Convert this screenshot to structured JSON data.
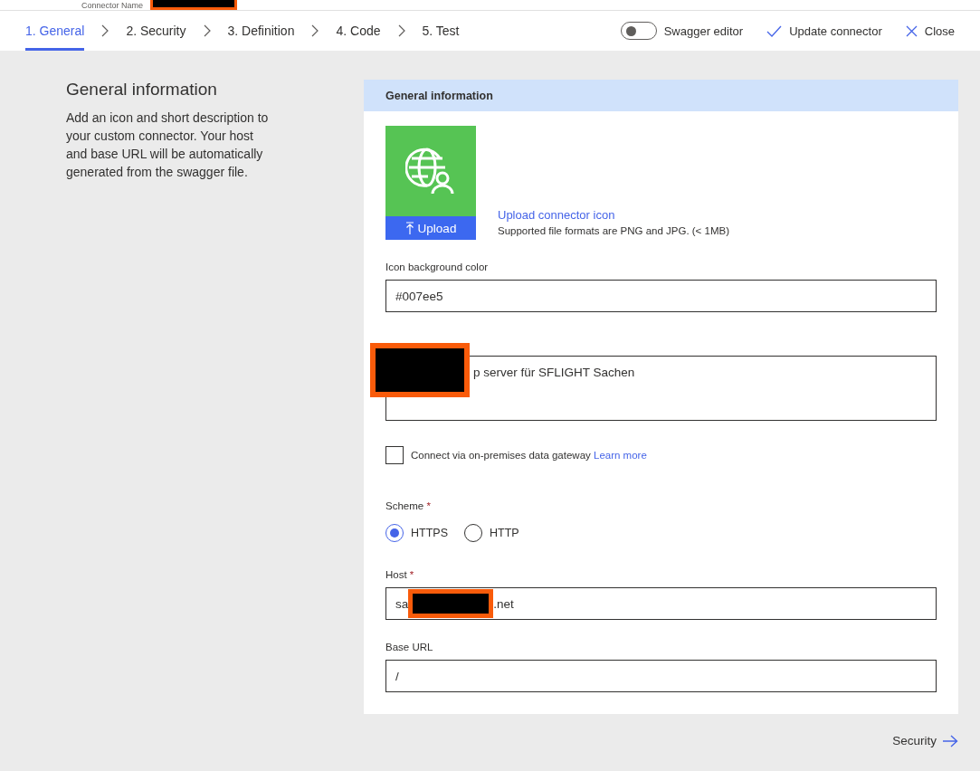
{
  "top_strip": {
    "label": "Connector Name"
  },
  "steps": [
    {
      "label": "1. General",
      "selected": true
    },
    {
      "label": "2. Security",
      "selected": false
    },
    {
      "label": "3. Definition",
      "selected": false
    },
    {
      "label": "4. Code",
      "selected": false
    },
    {
      "label": "5. Test",
      "selected": false
    }
  ],
  "toolbar": {
    "swagger_toggle": {
      "label": "Swagger editor",
      "on": false
    },
    "update": "Update connector",
    "close": "Close"
  },
  "intro": {
    "title": "General information",
    "text": "Add an icon and short description to your custom connector. Your host and base URL will be automatically generated from the swagger file."
  },
  "card": {
    "title": "General information",
    "upload_button": "Upload",
    "upload_link": "Upload connector icon",
    "formats": "Supported file formats are PNG and JPG. (< 1MB)",
    "icon_color": {
      "label": "Icon background color",
      "value": "#007ee5"
    },
    "description": {
      "value": "p server für SFLIGHT Sachen"
    },
    "gateway": {
      "label": "Connect via on-premises data gateway",
      "link": "Learn more",
      "checked": false
    },
    "scheme": {
      "label": "Scheme",
      "required": "*",
      "options": [
        {
          "label": "HTTPS",
          "selected": true
        },
        {
          "label": "HTTP",
          "selected": false
        }
      ]
    },
    "host": {
      "label": "Host",
      "required": "*",
      "value_start": "sa",
      "value_end": ".net"
    },
    "base_url": {
      "label": "Base URL",
      "value": "/"
    }
  },
  "next": {
    "label": "Security"
  }
}
